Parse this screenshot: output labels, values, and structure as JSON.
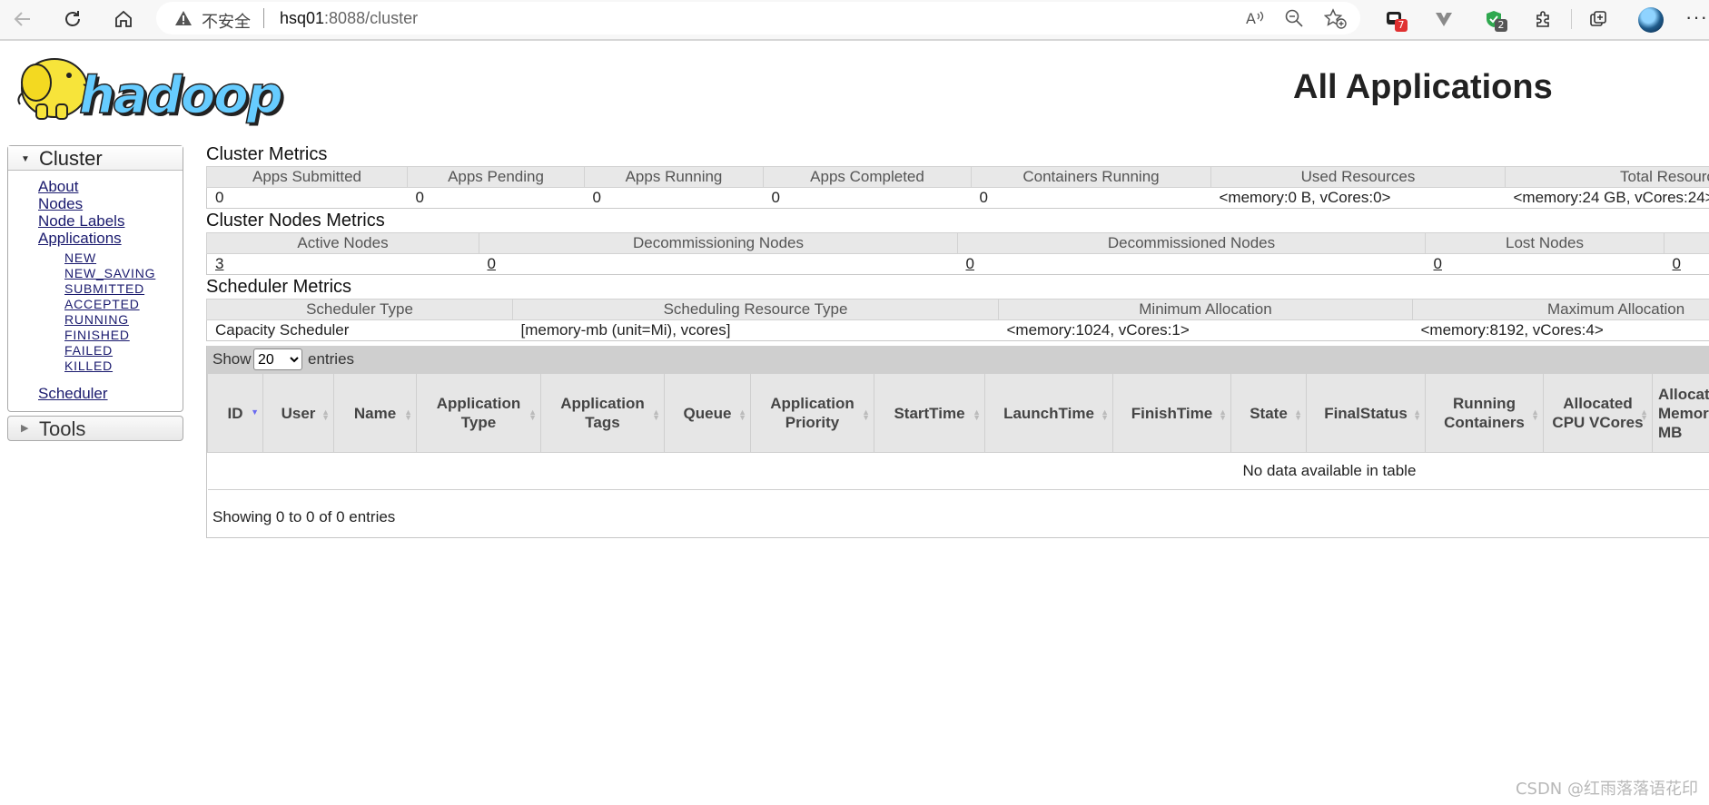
{
  "browser": {
    "security_label": "不安全",
    "url_host": "hsq01",
    "url_path": ":8088/cluster",
    "badges": {
      "ext1": "7",
      "ext3": "2"
    },
    "colors": {
      "badge_red": "#e03030",
      "badge_gray": "#555555",
      "shield_green": "#2fa84f"
    }
  },
  "page": {
    "logo_text": "hadoop",
    "title": "All Applications",
    "watermark": "CSDN @红雨落落语花印"
  },
  "sidebar": {
    "cluster_label": "Cluster",
    "links": {
      "about": "About",
      "nodes": "Nodes",
      "node_labels": "Node Labels",
      "applications": "Applications",
      "scheduler": "Scheduler"
    },
    "app_states": [
      "NEW",
      "NEW_SAVING",
      "SUBMITTED",
      "ACCEPTED",
      "RUNNING",
      "FINISHED",
      "FAILED",
      "KILLED"
    ],
    "tools_label": "Tools"
  },
  "cluster_metrics": {
    "title": "Cluster Metrics",
    "headers": [
      "Apps Submitted",
      "Apps Pending",
      "Apps Running",
      "Apps Completed",
      "Containers Running",
      "Used Resources",
      "Total Resources"
    ],
    "values": [
      "0",
      "0",
      "0",
      "0",
      "0",
      "<memory:0 B, vCores:0>",
      "<memory:24 GB, vCores:24>"
    ]
  },
  "nodes_metrics": {
    "title": "Cluster Nodes Metrics",
    "headers": [
      "Active Nodes",
      "Decommissioning Nodes",
      "Decommissioned Nodes",
      "Lost Nodes",
      ""
    ],
    "values": [
      "3",
      "0",
      "0",
      "0",
      "0"
    ]
  },
  "scheduler_metrics": {
    "title": "Scheduler Metrics",
    "headers": [
      "Scheduler Type",
      "Scheduling Resource Type",
      "Minimum Allocation",
      "Maximum Allocation"
    ],
    "values": [
      "Capacity Scheduler",
      "[memory-mb (unit=Mi), vcores]",
      "<memory:1024, vCores:1>",
      "<memory:8192, vCores:4>"
    ]
  },
  "apps": {
    "show_label": "Show",
    "page_size": "20",
    "entries_label": "entries",
    "columns": [
      "ID",
      "User",
      "Name",
      "Application Type",
      "Application Tags",
      "Queue",
      "Application Priority",
      "StartTime",
      "LaunchTime",
      "FinishTime",
      "State",
      "FinalStatus",
      "Running Containers",
      "Allocated CPU VCores",
      "Allocated Memory MB"
    ],
    "empty_message": "No data available in table",
    "info": "Showing 0 to 0 of 0 entries"
  }
}
